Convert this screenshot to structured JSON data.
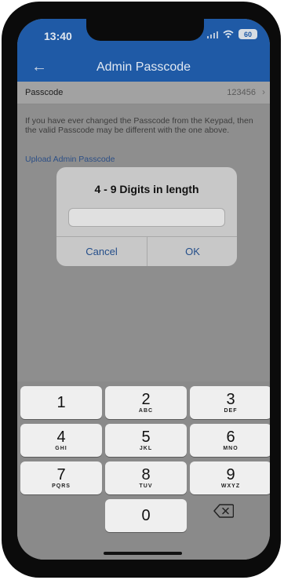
{
  "status_bar": {
    "time": "13:40",
    "battery": "60"
  },
  "nav": {
    "title": "Admin Passcode"
  },
  "passcode_row": {
    "label": "Passcode",
    "value": "123456"
  },
  "info_text": "If you have ever changed the Passcode from the Keypad, then the valid Passcode may be different with the one above.",
  "upload_link": "Upload Admin Passcode",
  "dialog": {
    "title": "4 - 9 Digits in length",
    "input_value": "",
    "cancel_label": "Cancel",
    "ok_label": "OK"
  },
  "keypad": [
    {
      "num": "1",
      "letters": ""
    },
    {
      "num": "2",
      "letters": "ABC"
    },
    {
      "num": "3",
      "letters": "DEF"
    },
    {
      "num": "4",
      "letters": "GHI"
    },
    {
      "num": "5",
      "letters": "JKL"
    },
    {
      "num": "6",
      "letters": "MNO"
    },
    {
      "num": "7",
      "letters": "PQRS"
    },
    {
      "num": "8",
      "letters": "TUV"
    },
    {
      "num": "9",
      "letters": "WXYZ"
    },
    {
      "num": "0",
      "letters": ""
    }
  ],
  "colors": {
    "nav_bar": "#1f5aa6",
    "link": "#2c4f86",
    "overlay": "#8e8e8e"
  }
}
